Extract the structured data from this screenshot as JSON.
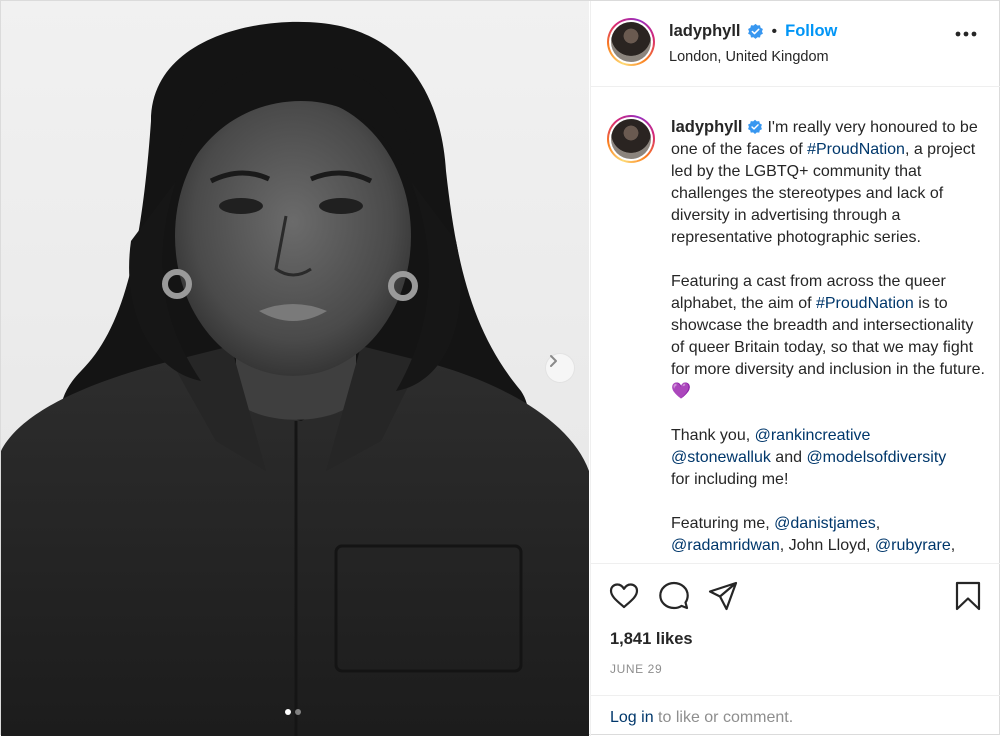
{
  "header": {
    "username": "ladyphyll",
    "separator": "•",
    "follow_label": "Follow",
    "location": "London, United Kingdom"
  },
  "caption": {
    "username": "ladyphyll",
    "p1_a": "I'm really very honoured to be one of the faces of ",
    "p1_tag": "#ProudNation",
    "p1_b": ", a project led by the LGBTQ+ community that challenges the stereotypes and lack of diversity in advertising through a representative photographic series.",
    "p2_a": "Featuring a cast from across the queer alphabet, the aim of ",
    "p2_tag": "#ProudNation",
    "p2_b": " is to showcase the breadth and intersectionality of queer Britain today, so that we may fight for more diversity and inclusion in the future. ",
    "p2_emoji": "💜",
    "p3_a": "Thank you, ",
    "p3_m1": "@rankincreative",
    "p3_m2": "@stonewalluk",
    "p3_b": " and ",
    "p3_m3": "@modelsofdiversity",
    "p3_c": " for including me!",
    "p4_a": "Featuring me, ",
    "p4_m1": "@danistjames",
    "p4_b": ",",
    "p4_m2": "@radamridwan",
    "p4_c": ", John Lloyd, ",
    "p4_m3": "@rubyrare",
    "p4_d": ","
  },
  "engagement": {
    "likes": "1,841 likes",
    "date": "JUNE 29"
  },
  "login": {
    "link": "Log in",
    "rest": " to like or comment."
  },
  "carousel": {
    "total": 2,
    "current": 1
  },
  "colors": {
    "follow_blue": "#0095f6",
    "link_navy": "#00376b",
    "muted_gray": "#8e8e8e",
    "verified_blue": "#3897f0"
  },
  "icons": [
    "verified-badge-icon",
    "more-options-icon",
    "heart-icon",
    "comment-icon",
    "share-icon",
    "bookmark-icon",
    "chevron-right-icon"
  ]
}
